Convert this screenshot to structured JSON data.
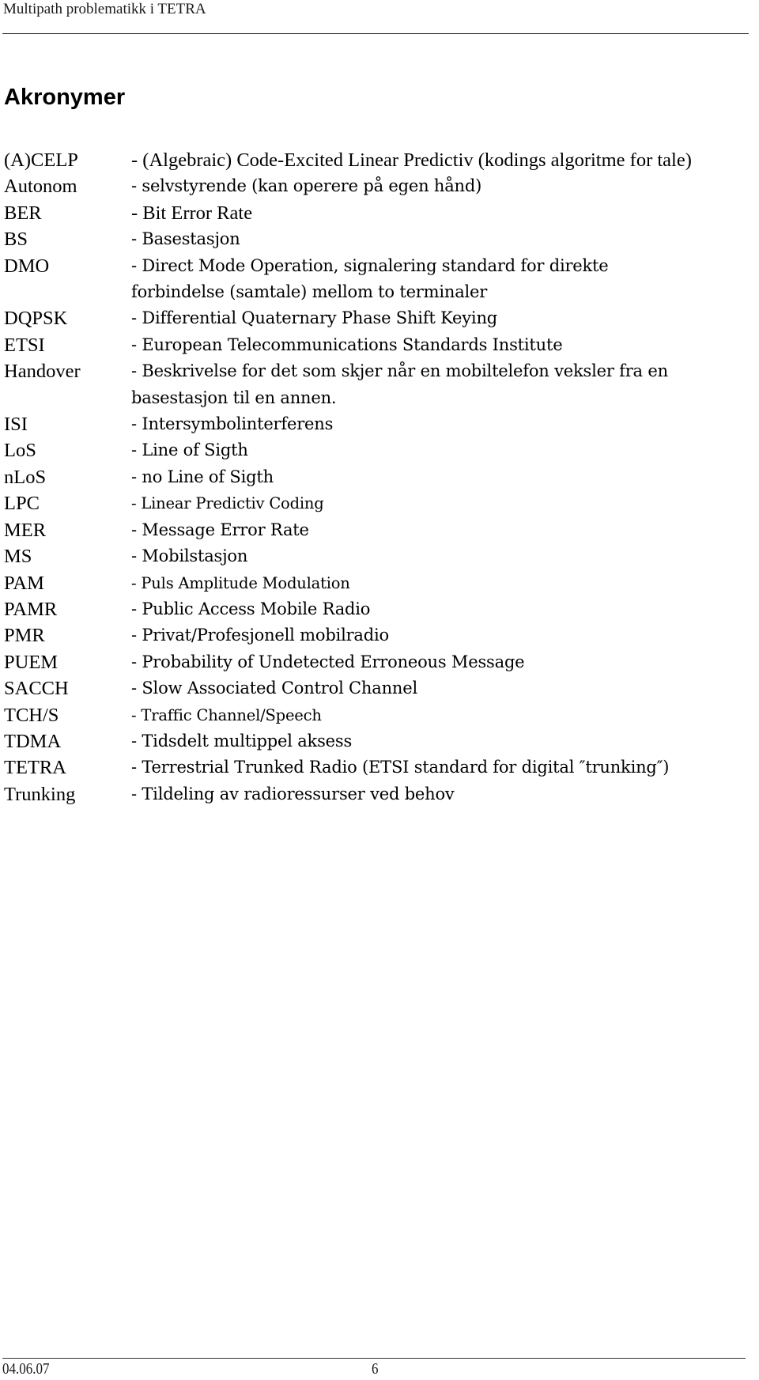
{
  "header": {
    "running_title": "Multipath problematikk i TETRA"
  },
  "section": {
    "title": "Akronymer"
  },
  "acronyms": [
    {
      "term": "(A)CELP",
      "definition": "- (Algebraic) Code-Excited Linear Predictiv (kodings algoritme for tale)",
      "style": "times"
    },
    {
      "term": "Autonom",
      "definition": "- selvstyrende (kan operere på egen hånd)",
      "style": "serif"
    },
    {
      "term": "BER",
      "definition": "- Bit Error Rate",
      "style": "times"
    },
    {
      "term": "BS",
      "definition": "- Basestasjon",
      "style": "serif"
    },
    {
      "term": "DMO",
      "definition": "- Direct Mode Operation, signalering standard for direkte\nforbindelse (samtale) mellom to terminaler",
      "style": "serif"
    },
    {
      "term": "DQPSK",
      "definition": "- Differential Quaternary Phase Shift Keying",
      "style": "serif"
    },
    {
      "term": "ETSI",
      "definition": "-  European Telecommunications Standards Institute",
      "style": "serif"
    },
    {
      "term": "Handover",
      "definition": "- Beskrivelse for det som skjer når en mobiltelefon veksler fra en\nbasestasjon til en annen.",
      "style": "serif"
    },
    {
      "term": "ISI",
      "definition": "- Intersymbolinterferens",
      "style": "serif"
    },
    {
      "term": "LoS",
      "definition": "- Line of Sigth",
      "style": "serif"
    },
    {
      "term": "nLoS",
      "definition": "- no Line of Sigth",
      "style": "serif"
    },
    {
      "term": "LPC",
      "definition": "- Linear Predictiv Coding",
      "style": "small"
    },
    {
      "term": "MER",
      "definition": "- Message Error Rate",
      "style": "serif"
    },
    {
      "term": "MS",
      "definition": "- Mobilstasjon",
      "style": "serif"
    },
    {
      "term": "PAM",
      "definition": "- Puls Amplitude Modulation",
      "style": "small"
    },
    {
      "term": "PAMR",
      "definition": "- Public Access Mobile Radio",
      "style": "serif"
    },
    {
      "term": "PMR",
      "definition": "- Privat/Profesjonell mobilradio",
      "style": "serif"
    },
    {
      "term": "PUEM",
      "definition": "- Probability of Undetected Erroneous Message",
      "style": "serif"
    },
    {
      "term": "SACCH",
      "definition": "- Slow Associated Control Channel",
      "style": "serif"
    },
    {
      "term": "TCH/S",
      "definition": "- Traffic Channel/Speech",
      "style": "small"
    },
    {
      "term": "TDMA",
      "definition": "- Tidsdelt multippel aksess",
      "style": "serif"
    },
    {
      "term": "TETRA",
      "definition": "- Terrestrial Trunked Radio (ETSI standard for digital ″trunking″)",
      "style": "serif"
    },
    {
      "term": "Trunking",
      "definition": "- Tildeling av radioressurser ved behov",
      "style": "serif"
    }
  ],
  "footer": {
    "date": "04.06.07",
    "page_number": "6"
  }
}
